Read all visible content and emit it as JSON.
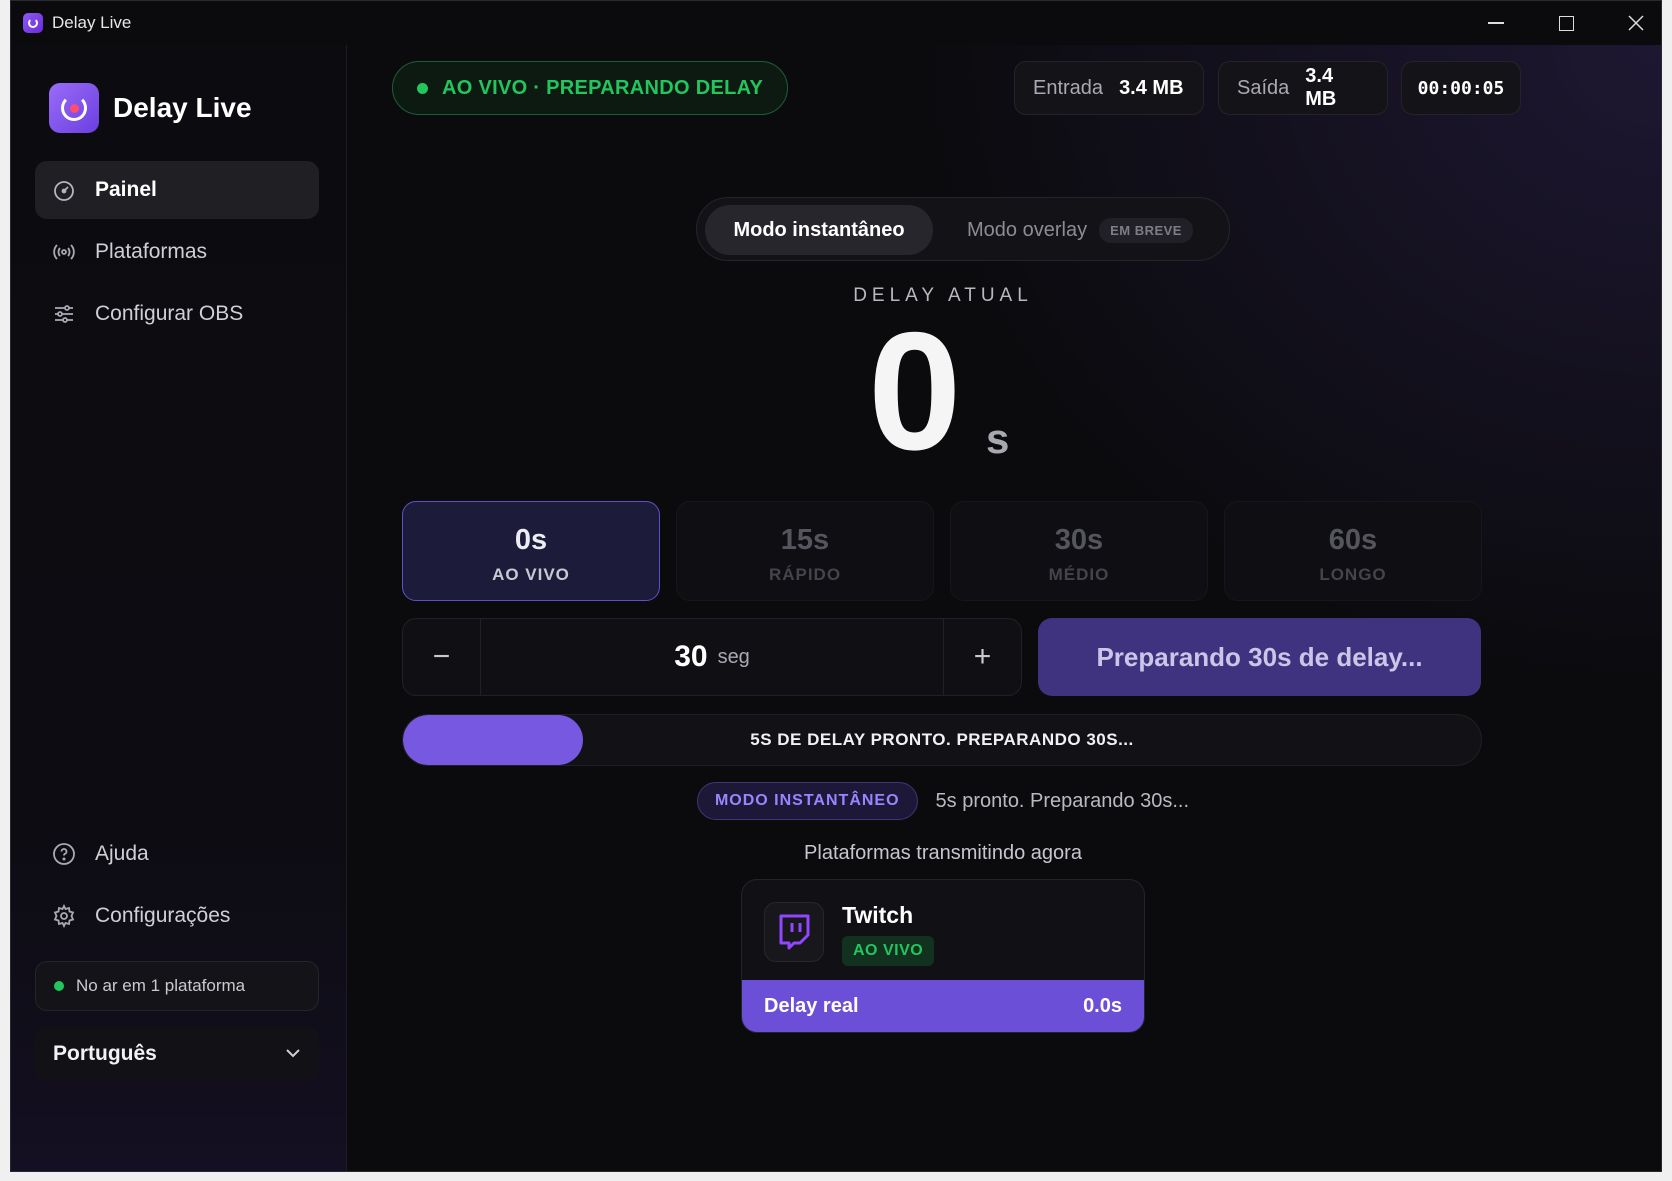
{
  "window": {
    "title": "Delay Live"
  },
  "sidebar": {
    "brand": "Delay Live",
    "nav": [
      {
        "label": "Painel",
        "icon": "speedometer-icon",
        "active": true
      },
      {
        "label": "Plataformas",
        "icon": "broadcast-icon"
      },
      {
        "label": "Configurar OBS",
        "icon": "sliders-icon"
      }
    ],
    "bottom_nav": [
      {
        "label": "Ajuda",
        "icon": "help-circle-icon"
      },
      {
        "label": "Configurações",
        "icon": "gear-icon"
      }
    ],
    "status": "No ar em 1 plataforma",
    "language": "Português"
  },
  "header": {
    "live_status": "AO VIVO · PREPARANDO DELAY",
    "input_label": "Entrada",
    "input_value": "3.4 MB",
    "output_label": "Saída",
    "output_value": "3.4 MB",
    "elapsed": "00:00:05"
  },
  "mode": {
    "instant": "Modo instantâneo",
    "overlay": "Modo overlay",
    "soon": "EM BREVE"
  },
  "delay": {
    "label": "DELAY ATUAL",
    "value": "0",
    "unit": "s"
  },
  "presets": [
    {
      "value": "0s",
      "tag": "AO VIVO",
      "active": true
    },
    {
      "value": "15s",
      "tag": "RÁPIDO"
    },
    {
      "value": "30s",
      "tag": "MÉDIO"
    },
    {
      "value": "60s",
      "tag": "LONGO"
    }
  ],
  "stepper": {
    "minus": "−",
    "value": "30",
    "unit": "seg",
    "plus": "+"
  },
  "prepare_button": "Preparando 30s de delay...",
  "progress": {
    "fraction": 0.167,
    "text": "5S DE DELAY PRONTO. PREPARANDO 30S..."
  },
  "mode_status": {
    "tag": "MODO INSTANTÂNEO",
    "message": "5s pronto. Preparando 30s..."
  },
  "platforms": {
    "title": "Plataformas transmitindo agora",
    "items": [
      {
        "name": "Twitch",
        "status": "AO VIVO",
        "delay_label": "Delay real",
        "delay_value": "0.0s"
      }
    ]
  },
  "colors": {
    "accent": "#7659e0",
    "live": "#22c55e"
  }
}
